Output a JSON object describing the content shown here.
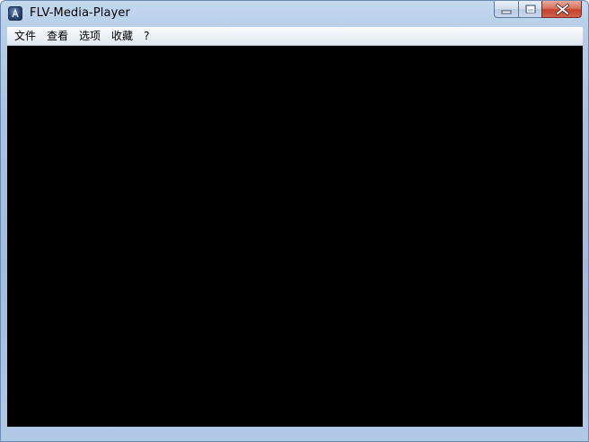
{
  "window": {
    "title": "FLV-Media-Player"
  },
  "titlebar": {
    "app_icon": "flv-player-app-icon",
    "buttons": {
      "minimize_icon": "minimize-icon",
      "maximize_icon": "maximize-icon",
      "close_icon": "close-icon"
    }
  },
  "menubar": {
    "items": [
      {
        "label": "文件"
      },
      {
        "label": "查看"
      },
      {
        "label": "选项"
      },
      {
        "label": "收藏"
      },
      {
        "label": "?"
      }
    ]
  },
  "video": {
    "background_color": "#000000"
  },
  "colors": {
    "frame": "#a9c3e3",
    "close_button": "#c2442e",
    "menu_bar": "#eef2f8"
  }
}
